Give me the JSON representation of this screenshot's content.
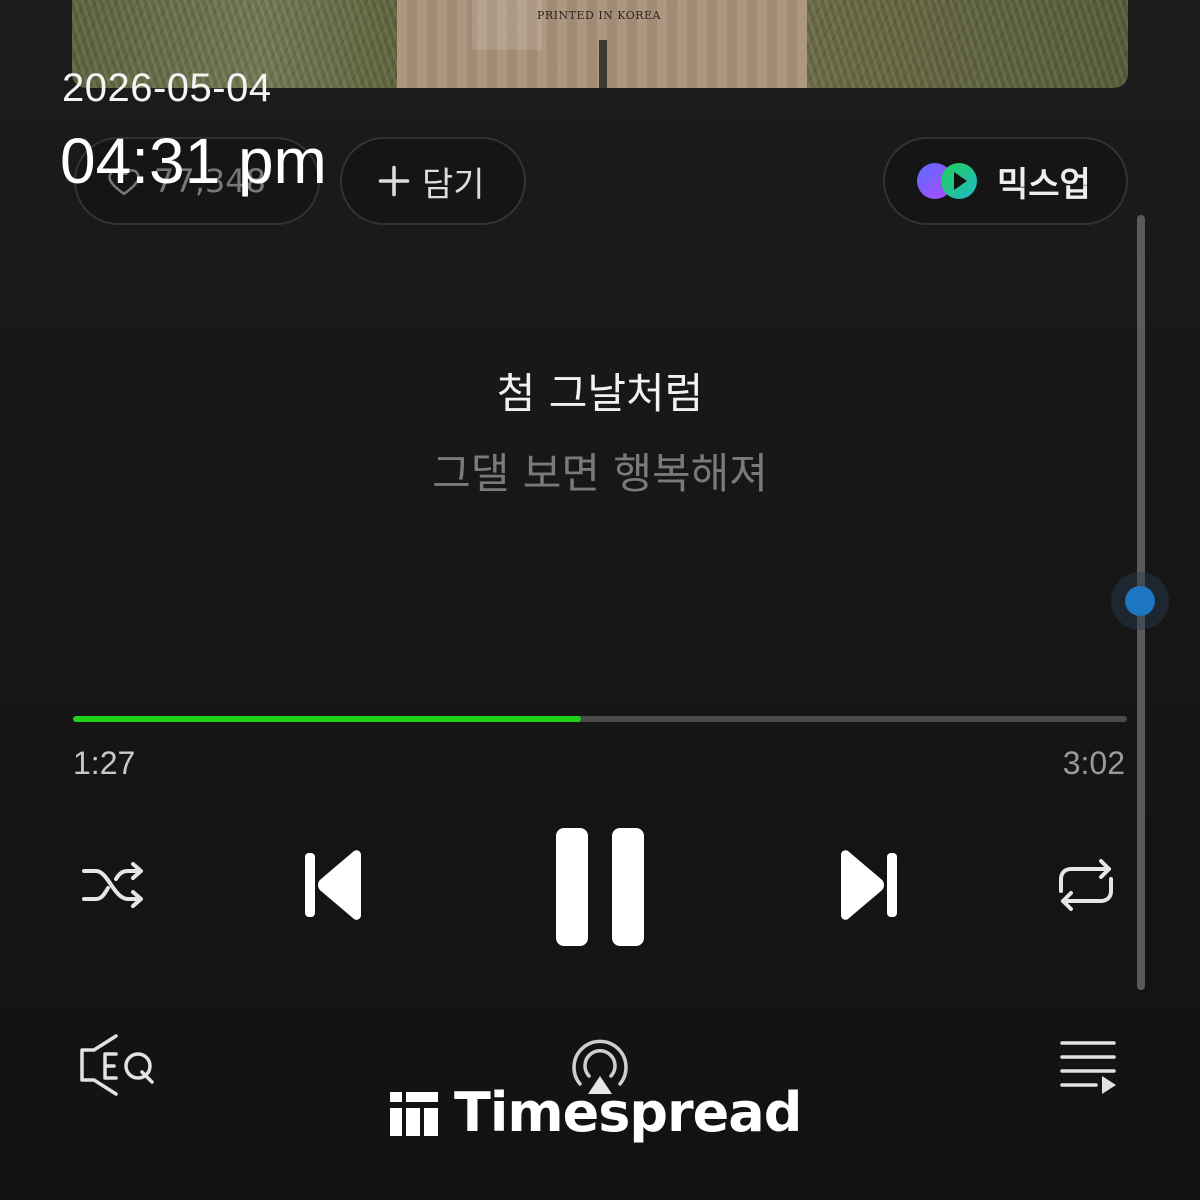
{
  "album": {
    "printed_text": "PRINTED IN KOREA"
  },
  "overlay": {
    "date": "2026-05-04",
    "time": "04:31 pm"
  },
  "actions": {
    "like_count": "77,348",
    "add_label": "담기",
    "mixup_label": "믹스업"
  },
  "lyrics": {
    "current": "첨 그날처럼",
    "next": "그댈 보면 행복해져"
  },
  "player": {
    "elapsed": "1:27",
    "total": "3:02",
    "progress_fraction": 0.482
  },
  "icons": {
    "like": "heart-icon",
    "add": "plus-icon",
    "mixup": "mixup-icon",
    "shuffle": "shuffle-icon",
    "previous": "skip-previous-icon",
    "pause": "pause-icon",
    "next": "skip-next-icon",
    "repeat": "repeat-icon",
    "eq": "eq-icon",
    "cast": "airplay-icon",
    "playlist": "playlist-icon"
  },
  "colors": {
    "accent_green": "#1ed21b",
    "scroll_blue": "#1d76c2",
    "background": "#141414"
  },
  "watermark": {
    "text": "Timespread"
  }
}
